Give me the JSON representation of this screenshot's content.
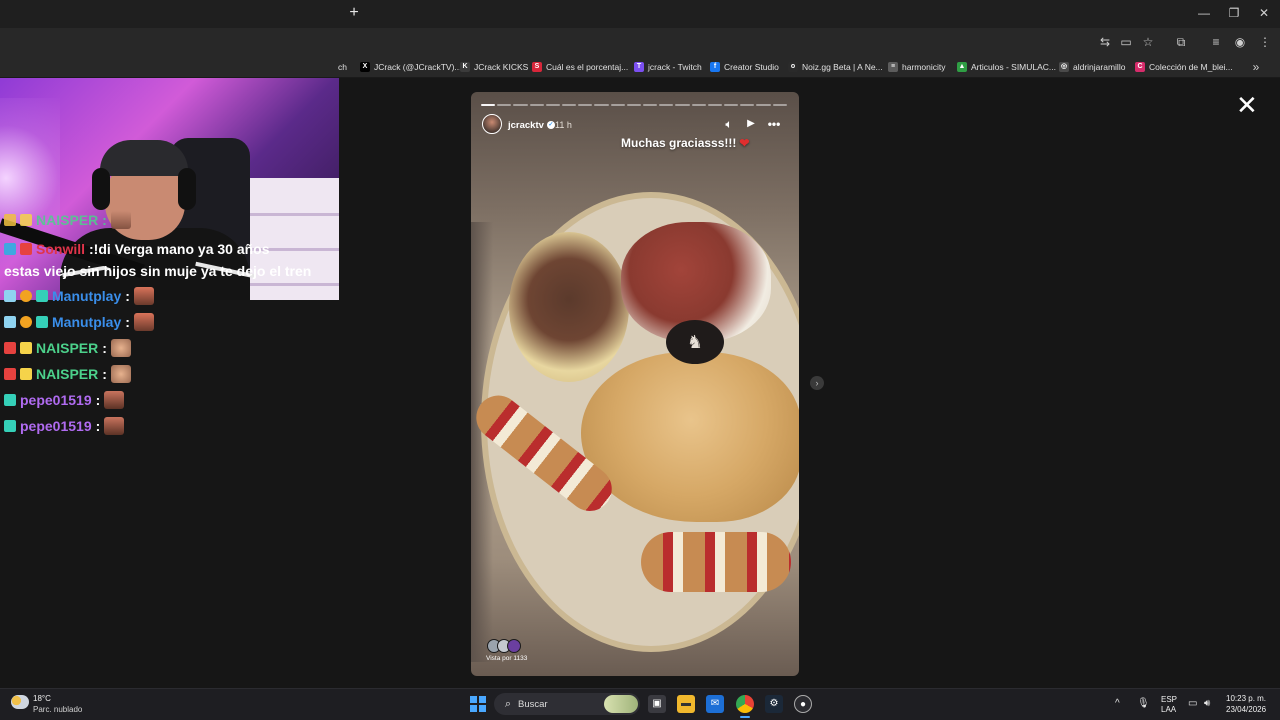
{
  "browser": {
    "bookmarks": [
      {
        "label": "ch",
        "icon": "tab-fragment",
        "color": "#282828"
      },
      {
        "label": "JCrack (@JCrackTV)...",
        "icon": "x-logo-icon",
        "color": "#000000",
        "glyph": "X"
      },
      {
        "label": "JCrack KICKS",
        "icon": "kick-icon",
        "color": "#3b3b3b",
        "glyph": "K"
      },
      {
        "label": "Cuál es el porcentaj...",
        "icon": "s-icon",
        "color": "#d8263a",
        "glyph": "S"
      },
      {
        "label": "jcrack - Twitch",
        "icon": "twitch-icon",
        "color": "#7b4ff0",
        "glyph": "T"
      },
      {
        "label": "Creator Studio",
        "icon": "facebook-icon",
        "color": "#1877f2",
        "glyph": "f"
      },
      {
        "label": "Noiz.gg Beta | A Ne...",
        "icon": "noiz-icon",
        "color": "#2a2a2a",
        "glyph": "o"
      },
      {
        "label": "harmonicity",
        "icon": "notes-icon",
        "color": "#5c5c5c",
        "glyph": "≡"
      },
      {
        "label": "Articulos - SIMULAC...",
        "icon": "drive-icon",
        "color": "#2f9e44",
        "glyph": "▲"
      },
      {
        "label": "aldrinjaramillo",
        "icon": "globe-icon",
        "color": "#4a4a4a",
        "glyph": "◎"
      },
      {
        "label": "Colección de M_blei...",
        "icon": "collection-icon",
        "color": "#d62c6b",
        "glyph": "C"
      }
    ]
  },
  "chat": {
    "partial_top": "NAISPER :",
    "messages": [
      {
        "user": "Sonwill",
        "color": "#e0344a",
        "text": ":!di Verga mano ya 30 años",
        "continuation": "estas viejo sin hijos sin muje ya te dejo el tren"
      },
      {
        "user": "Manutplay",
        "color": "#3a8eea",
        "text": ":"
      },
      {
        "user": "Manutplay",
        "color": "#3a8eea",
        "text": ":"
      },
      {
        "user": "NAISPER",
        "color": "#4cd18b",
        "text": ":"
      },
      {
        "user": "NAISPER",
        "color": "#4cd18b",
        "text": ":"
      },
      {
        "user": "pepe01519",
        "color": "#b06bf0",
        "text": ":"
      },
      {
        "user": "pepe01519",
        "color": "#b06bf0",
        "text": ":"
      }
    ]
  },
  "story": {
    "username": "jcracktv",
    "time": "11 h",
    "caption": "Muchas graciasss!!!",
    "views": "Vista por 1133",
    "segments": 19,
    "active_segment": 0
  },
  "taskbar": {
    "weather_temp": "18°C",
    "weather_desc": "Parc. nublado",
    "search_placeholder": "Buscar",
    "lang_line1": "ESP",
    "lang_line2": "LAA",
    "time": "10:23 p. m.",
    "date": "23/04/2026"
  }
}
